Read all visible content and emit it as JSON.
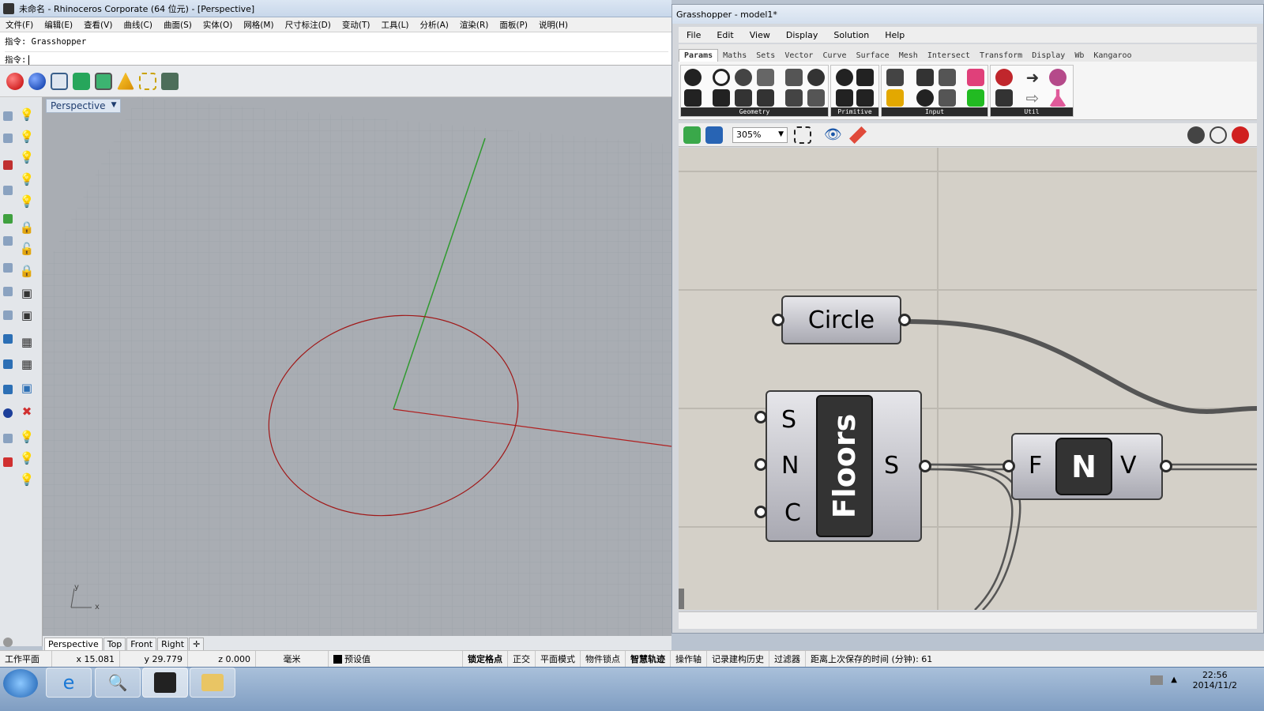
{
  "rhino": {
    "title": "未命名 - Rhinoceros Corporate (64 位元) - [Perspective]",
    "menu": [
      "文件(F)",
      "编辑(E)",
      "查看(V)",
      "曲线(C)",
      "曲面(S)",
      "实体(O)",
      "网格(M)",
      "尺寸标注(D)",
      "变动(T)",
      "工具(L)",
      "分析(A)",
      "渲染(R)",
      "面板(P)",
      "说明(H)"
    ],
    "command_history": "指令: Grasshopper",
    "command_prompt": "指令:",
    "viewport_label": "Perspective",
    "viewport_tabs": [
      "Perspective",
      "Top",
      "Front",
      "Right"
    ],
    "axis_x": "x",
    "axis_y": "y"
  },
  "status_bar": {
    "cplane": "工作平面",
    "x": "x 15.081",
    "y": "y 29.779",
    "z": "z 0.000",
    "units": "毫米",
    "layer": "预设值",
    "toggles": [
      "锁定格点",
      "正交",
      "平面模式",
      "物件锁点",
      "智慧轨迹",
      "操作轴",
      "记录建构历史",
      "过滤器"
    ],
    "saved": "距离上次保存的时间 (分钟): 61"
  },
  "taskbar": {
    "time": "22:56",
    "date": "2014/11/2"
  },
  "grasshopper": {
    "title": "Grasshopper - model1*",
    "menu": [
      "File",
      "Edit",
      "View",
      "Display",
      "Solution",
      "Help"
    ],
    "tabs": [
      "Params",
      "Maths",
      "Sets",
      "Vector",
      "Curve",
      "Surface",
      "Mesh",
      "Intersect",
      "Transform",
      "Display",
      "Wb",
      "Kangaroo"
    ],
    "ribbon_groups": [
      "Geometry",
      "Primitive",
      "Input",
      "Util"
    ],
    "zoom": "305%",
    "components": {
      "circle": {
        "label": "Circle"
      },
      "floors": {
        "label": "Floors",
        "inputs": [
          "S",
          "N",
          "C"
        ],
        "output": "S"
      },
      "number": {
        "label": "N",
        "input": "F",
        "output": "V"
      }
    }
  },
  "colors": {
    "accent": "#d7a600",
    "circle_curve": "#a01818",
    "axis_red": "#b02020",
    "axis_green": "#2f9a2f"
  }
}
